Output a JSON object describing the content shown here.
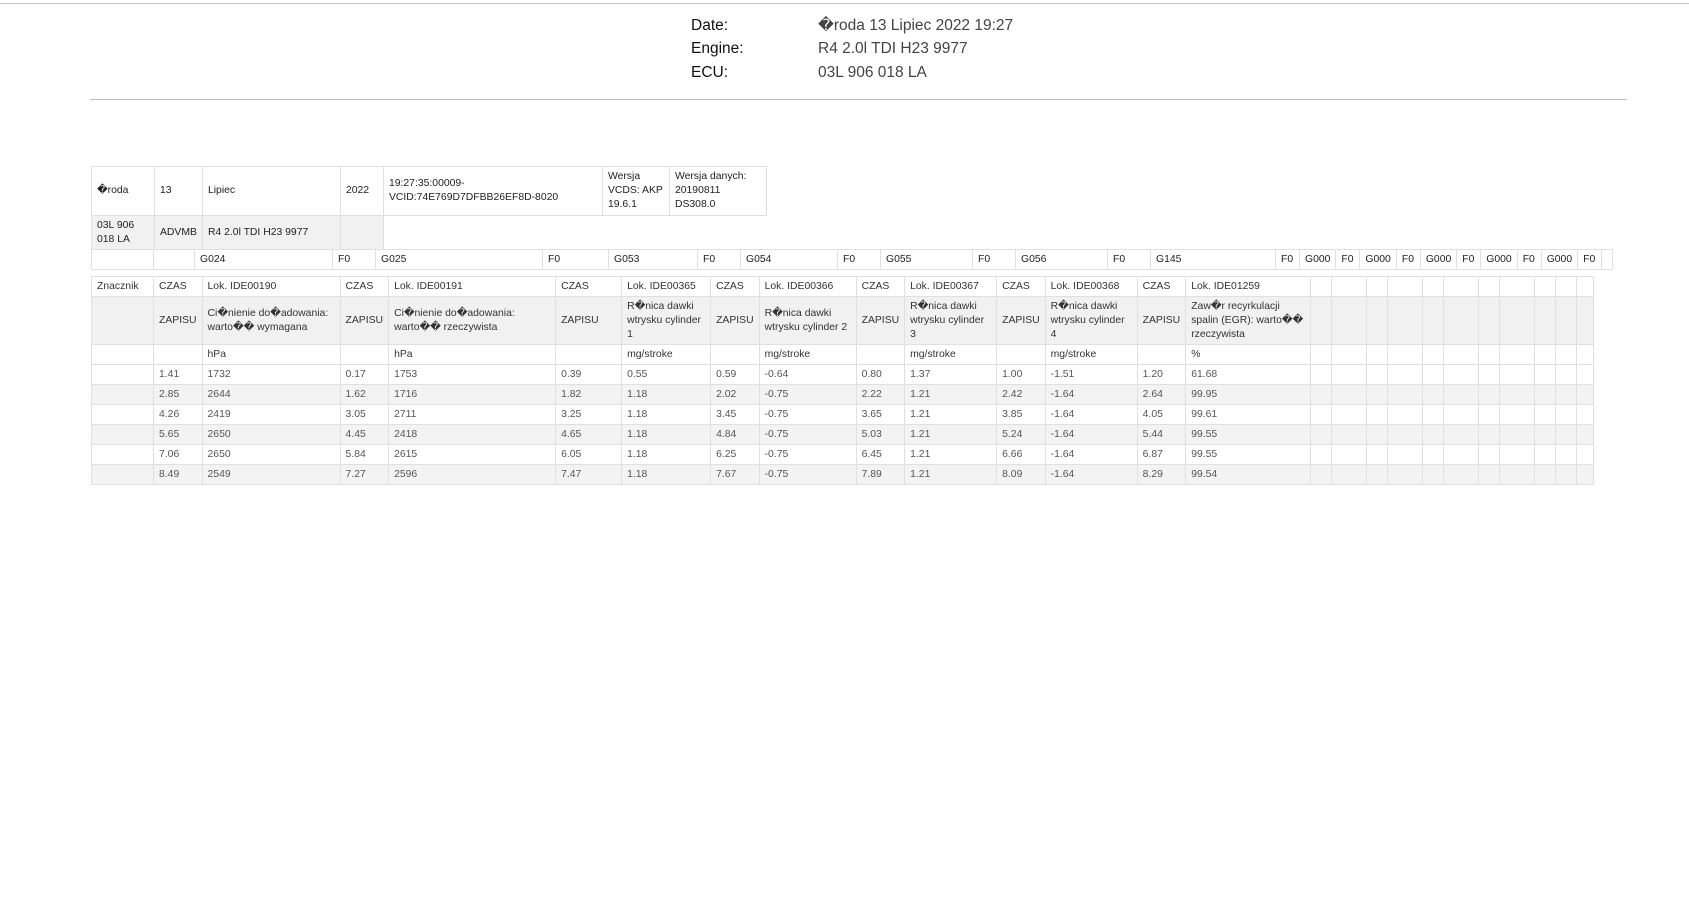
{
  "header": {
    "date_label": "Date:",
    "date_value": "�roda 13 Lipiec 2022 19:27",
    "engine_label": "Engine:",
    "engine_value": "R4 2.0l TDI H23 9977",
    "ecu_label": "ECU:",
    "ecu_value": "03L 906 018 LA"
  },
  "info": {
    "day": "�roda",
    "daynum": "13",
    "month": "Lipiec",
    "year": "2022",
    "time_vcid": "19:27:35:00009-VCID:74E769D7DFBB26EF8D-8020",
    "vcds_version": "Wersja VCDS: AKP 19.6.1",
    "data_version": "Wersja danych: 20190811 DS308.0",
    "ecu": "03L 906 018 LA",
    "advmb": "ADVMB",
    "engine": "R4 2.0l TDI H23 9977"
  },
  "codes_row": [
    "",
    "",
    "G024",
    "F0",
    "G025",
    "F0",
    "G053",
    "F0",
    "G054",
    "F0",
    "G055",
    "F0",
    "G056",
    "F0",
    "G145",
    "F0",
    "G000",
    "F0",
    "G000",
    "F0",
    "G000",
    "F0",
    "G000",
    "F0",
    "G000",
    "F0",
    ""
  ],
  "table": {
    "row_lok": [
      "Znacznik",
      "CZAS",
      "Lok. IDE00190",
      "CZAS",
      "Lok. IDE00191",
      "CZAS",
      "Lok. IDE00365",
      "CZAS",
      "Lok. IDE00366",
      "CZAS",
      "Lok. IDE00367",
      "CZAS",
      "Lok. IDE00368",
      "CZAS",
      "Lok. IDE01259",
      "",
      "",
      "",
      "",
      "",
      "",
      "",
      "",
      "",
      "",
      ""
    ],
    "row_desc": [
      "",
      "ZAPISU",
      "Ci�nienie do�adowania: warto�� wymagana",
      "ZAPISU",
      "Ci�nienie do�adowania: warto�� rzeczywista",
      "ZAPISU",
      "R�nica dawki wtrysku cylinder 1",
      "ZAPISU",
      "R�nica dawki wtrysku cylinder 2",
      "ZAPISU",
      "R�nica dawki wtrysku cylinder 3",
      "ZAPISU",
      "R�nica dawki wtrysku cylinder 4",
      "ZAPISU",
      "Zaw�r recyrkulacji spalin (EGR): warto�� rzeczywista",
      "",
      "",
      "",
      "",
      "",
      "",
      "",
      "",
      "",
      "",
      ""
    ],
    "row_unit": [
      "",
      "",
      "hPa",
      "",
      "hPa",
      "",
      "mg/stroke",
      "",
      "mg/stroke",
      "",
      "mg/stroke",
      "",
      "mg/stroke",
      "",
      "%",
      "",
      "",
      "",
      "",
      "",
      "",
      "",
      "",
      "",
      "",
      ""
    ],
    "rows": [
      [
        "",
        "1.41",
        "1732",
        "0.17",
        "1753",
        "0.39",
        "0.55",
        "0.59",
        "-0.64",
        "0.80",
        "1.37",
        "1.00",
        "-1.51",
        "1.20",
        "61.68",
        "",
        "",
        "",
        "",
        "",
        "",
        "",
        "",
        "",
        "",
        ""
      ],
      [
        "",
        "2.85",
        "2644",
        "1.62",
        "1716",
        "1.82",
        "1.18",
        "2.02",
        "-0.75",
        "2.22",
        "1.21",
        "2.42",
        "-1.64",
        "2.64",
        "99.95",
        "",
        "",
        "",
        "",
        "",
        "",
        "",
        "",
        "",
        "",
        ""
      ],
      [
        "",
        "4.26",
        "2419",
        "3.05",
        "2711",
        "3.25",
        "1.18",
        "3.45",
        "-0.75",
        "3.65",
        "1.21",
        "3.85",
        "-1.64",
        "4.05",
        "99.61",
        "",
        "",
        "",
        "",
        "",
        "",
        "",
        "",
        "",
        "",
        ""
      ],
      [
        "",
        "5.65",
        "2650",
        "4.45",
        "2418",
        "4.65",
        "1.18",
        "4.84",
        "-0.75",
        "5.03",
        "1.21",
        "5.24",
        "-1.64",
        "5.44",
        "99.55",
        "",
        "",
        "",
        "",
        "",
        "",
        "",
        "",
        "",
        "",
        ""
      ],
      [
        "",
        "7.06",
        "2650",
        "5.84",
        "2615",
        "6.05",
        "1.18",
        "6.25",
        "-0.75",
        "6.45",
        "1.21",
        "6.66",
        "-1.64",
        "6.87",
        "99.55",
        "",
        "",
        "",
        "",
        "",
        "",
        "",
        "",
        "",
        "",
        ""
      ],
      [
        "",
        "8.49",
        "2549",
        "7.27",
        "2596",
        "7.47",
        "1.18",
        "7.67",
        "-0.75",
        "7.89",
        "1.21",
        "8.09",
        "-1.64",
        "8.29",
        "99.54",
        "",
        "",
        "",
        "",
        "",
        "",
        "",
        "",
        "",
        "",
        ""
      ]
    ]
  }
}
